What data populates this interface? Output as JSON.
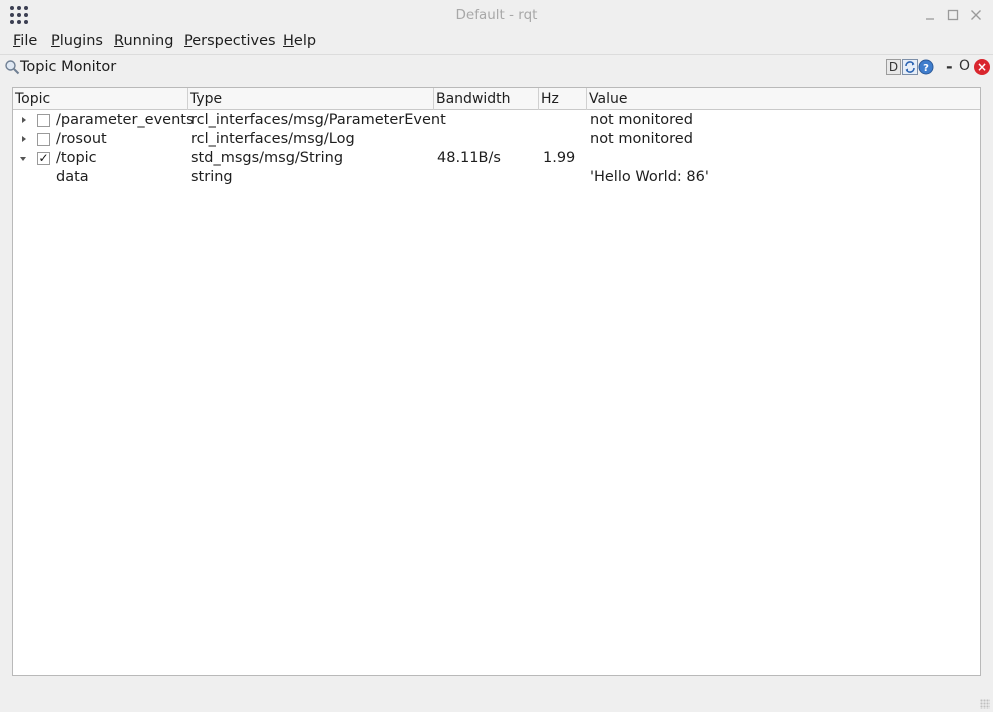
{
  "window": {
    "title": "Default - rqt",
    "controls": [
      "minimize-icon",
      "maximize-icon",
      "close-icon"
    ]
  },
  "menubar": {
    "items": [
      {
        "label_u": "F",
        "label_rest": "ile"
      },
      {
        "label_u": "P",
        "label_rest": "lugins"
      },
      {
        "label_u": "R",
        "label_rest": "unning"
      },
      {
        "label_u": "P",
        "label_rest": "erspectives"
      },
      {
        "label_u": "H",
        "label_rest": "elp"
      }
    ]
  },
  "dock": {
    "title": "Topic Monitor",
    "d_button": "D",
    "minus": "-",
    "float": "O",
    "close": "×"
  },
  "tree": {
    "headers": [
      "Topic",
      "Type",
      "Bandwidth",
      "Hz",
      "Value"
    ],
    "rows": [
      {
        "topic": "/parameter_events",
        "type": "rcl_interfaces/msg/ParameterEvent",
        "bandwidth": "",
        "hz": "",
        "value": "not monitored",
        "expanded": false,
        "checked": false
      },
      {
        "topic": "/rosout",
        "type": "rcl_interfaces/msg/Log",
        "bandwidth": "",
        "hz": "",
        "value": "not monitored",
        "expanded": false,
        "checked": false
      },
      {
        "topic": "/topic",
        "type": "std_msgs/msg/String",
        "bandwidth": "48.11B/s",
        "hz": "1.99",
        "value": "",
        "expanded": true,
        "checked": true,
        "check_mark": "✓"
      },
      {
        "topic": "data",
        "type": "string",
        "bandwidth": "",
        "hz": "",
        "value": "'Hello World: 86'",
        "child": true
      }
    ]
  },
  "colors": {
    "close_red": "#d9262e",
    "window_bg": "#efefef",
    "title_grey": "#a8a8a8"
  }
}
